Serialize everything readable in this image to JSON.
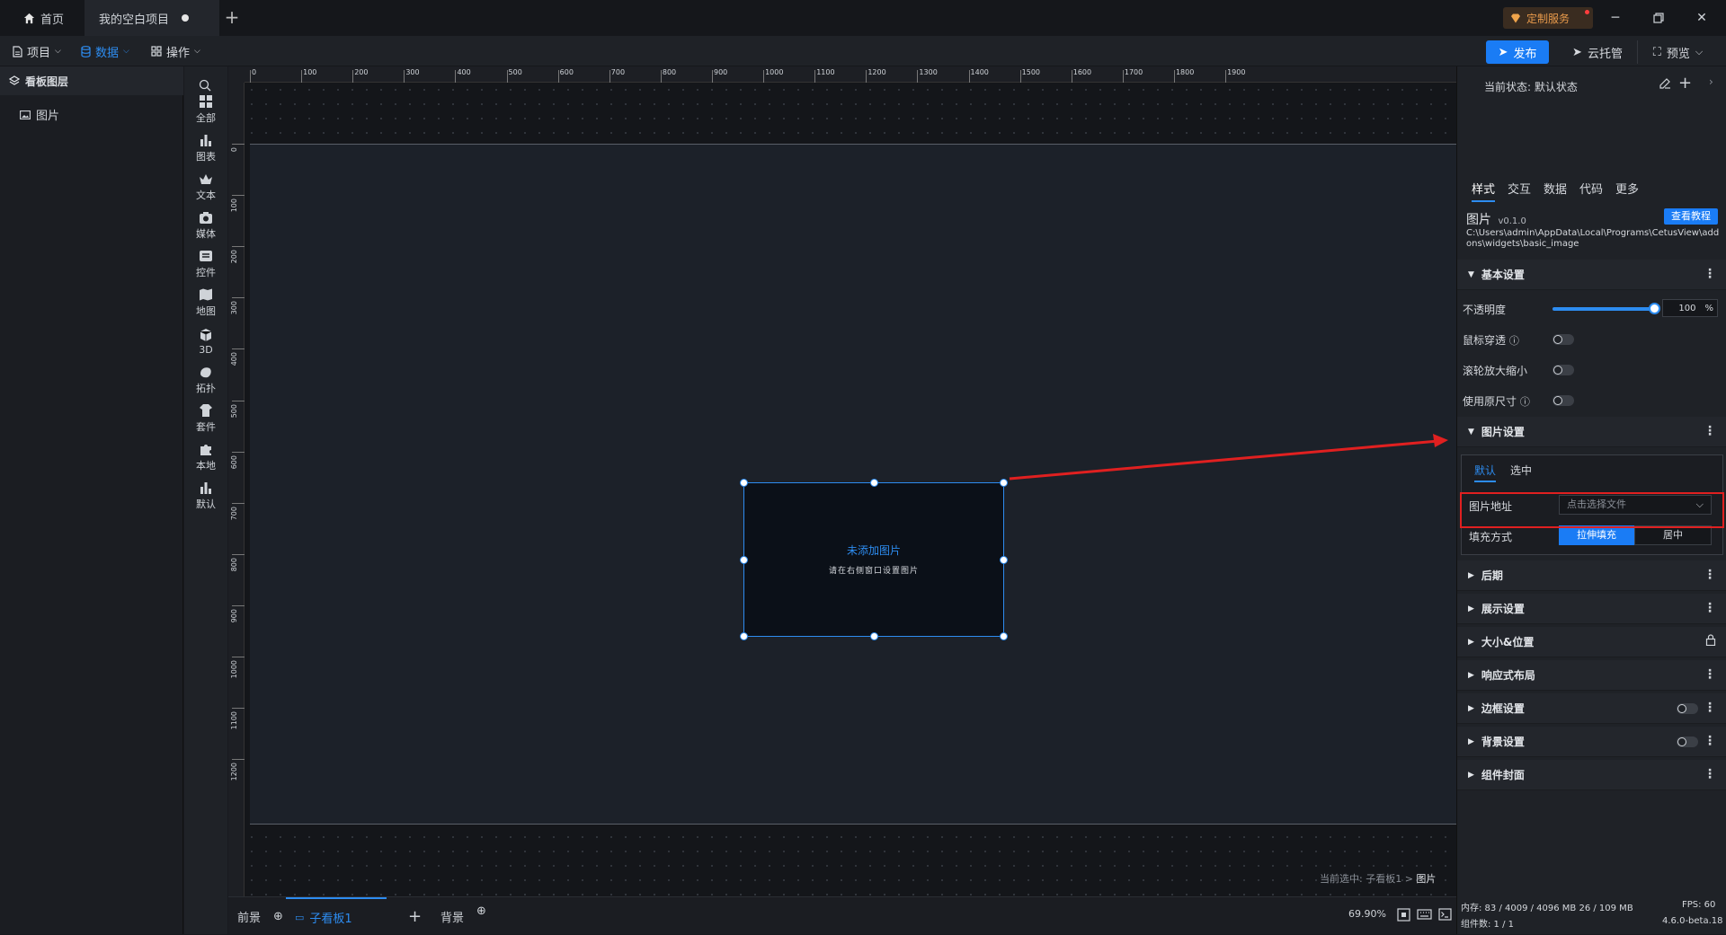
{
  "titlebar": {
    "home_tab": "首页",
    "project_tab": "我的空白项目",
    "custom_service": "定制服务"
  },
  "menubar": {
    "project": "项目",
    "data": "数据",
    "operation": "操作",
    "publish": "发布",
    "cloud": "云托管",
    "preview": "预览"
  },
  "layers": {
    "title": "看板图层",
    "items": [
      {
        "label": "图片"
      }
    ]
  },
  "categories": [
    {
      "label": "全部",
      "icon": "grid-icon"
    },
    {
      "label": "图表",
      "icon": "bar-chart-icon"
    },
    {
      "label": "文本",
      "icon": "text-icon"
    },
    {
      "label": "媒体",
      "icon": "media-icon"
    },
    {
      "label": "控件",
      "icon": "control-icon"
    },
    {
      "label": "地图",
      "icon": "map-icon"
    },
    {
      "label": "3D",
      "icon": "cube-icon"
    },
    {
      "label": "拓扑",
      "icon": "topology-icon"
    },
    {
      "label": "套件",
      "icon": "kit-icon"
    },
    {
      "label": "本地",
      "icon": "puzzle-icon"
    },
    {
      "label": "默认",
      "icon": "bar-chart-icon"
    }
  ],
  "ruler": {
    "top": [
      "0",
      "100",
      "200",
      "300",
      "400",
      "500",
      "600",
      "700",
      "800",
      "900",
      "1000",
      "1100",
      "1200",
      "1300",
      "1400",
      "1500",
      "1600",
      "1700",
      "1800",
      "1900"
    ],
    "left": [
      "0",
      "100",
      "200",
      "300",
      "400",
      "500",
      "600",
      "700",
      "800",
      "900",
      "1000",
      "1100",
      "1200"
    ]
  },
  "widget": {
    "title": "未添加图片",
    "subtitle": "请在右侧窗口设置图片"
  },
  "breadcrumb": {
    "prefix": "当前选中: 子看板1 >",
    "current": "图片"
  },
  "bottombar": {
    "foreground": "前景",
    "subboard": "子看板1",
    "background": "背景",
    "zoom": "69.90%"
  },
  "props": {
    "state_label": "当前状态:",
    "state_value": "默认状态",
    "tabs": [
      "样式",
      "交互",
      "数据",
      "代码",
      "更多"
    ],
    "component_name": "图片",
    "component_version": "v0.1.0",
    "tutorial": "查看教程",
    "path": "C:\\Users\\admin\\AppData\\Local\\Programs\\CetusView\\addons\\widgets\\basic_image",
    "basic_section": "基本设置",
    "opacity_label": "不透明度",
    "opacity_value": "100",
    "opacity_unit": "%",
    "mouse_through": "鼠标穿透",
    "wheel_zoom": "滚轮放大缩小",
    "original_size": "使用原尺寸",
    "image_section": "图片设置",
    "image_subtabs": [
      "默认",
      "选中"
    ],
    "image_url_label": "图片地址",
    "image_url_placeholder": "点击选择文件",
    "fill_label": "填充方式",
    "fill_options": [
      "拉伸填充",
      "居中"
    ],
    "sections": [
      "后期",
      "展示设置",
      "大小&位置",
      "响应式布局",
      "边框设置",
      "背景设置",
      "组件封面"
    ]
  },
  "status": {
    "memory": "内存: 83 / 4009 / 4096 MB  26 / 109 MB",
    "fps": "FPS: 60",
    "components": "组件数: 1 / 1",
    "version": "4.6.0-beta.18"
  },
  "colors": {
    "accent": "#2d8cf0",
    "annotation": "#e02020"
  }
}
